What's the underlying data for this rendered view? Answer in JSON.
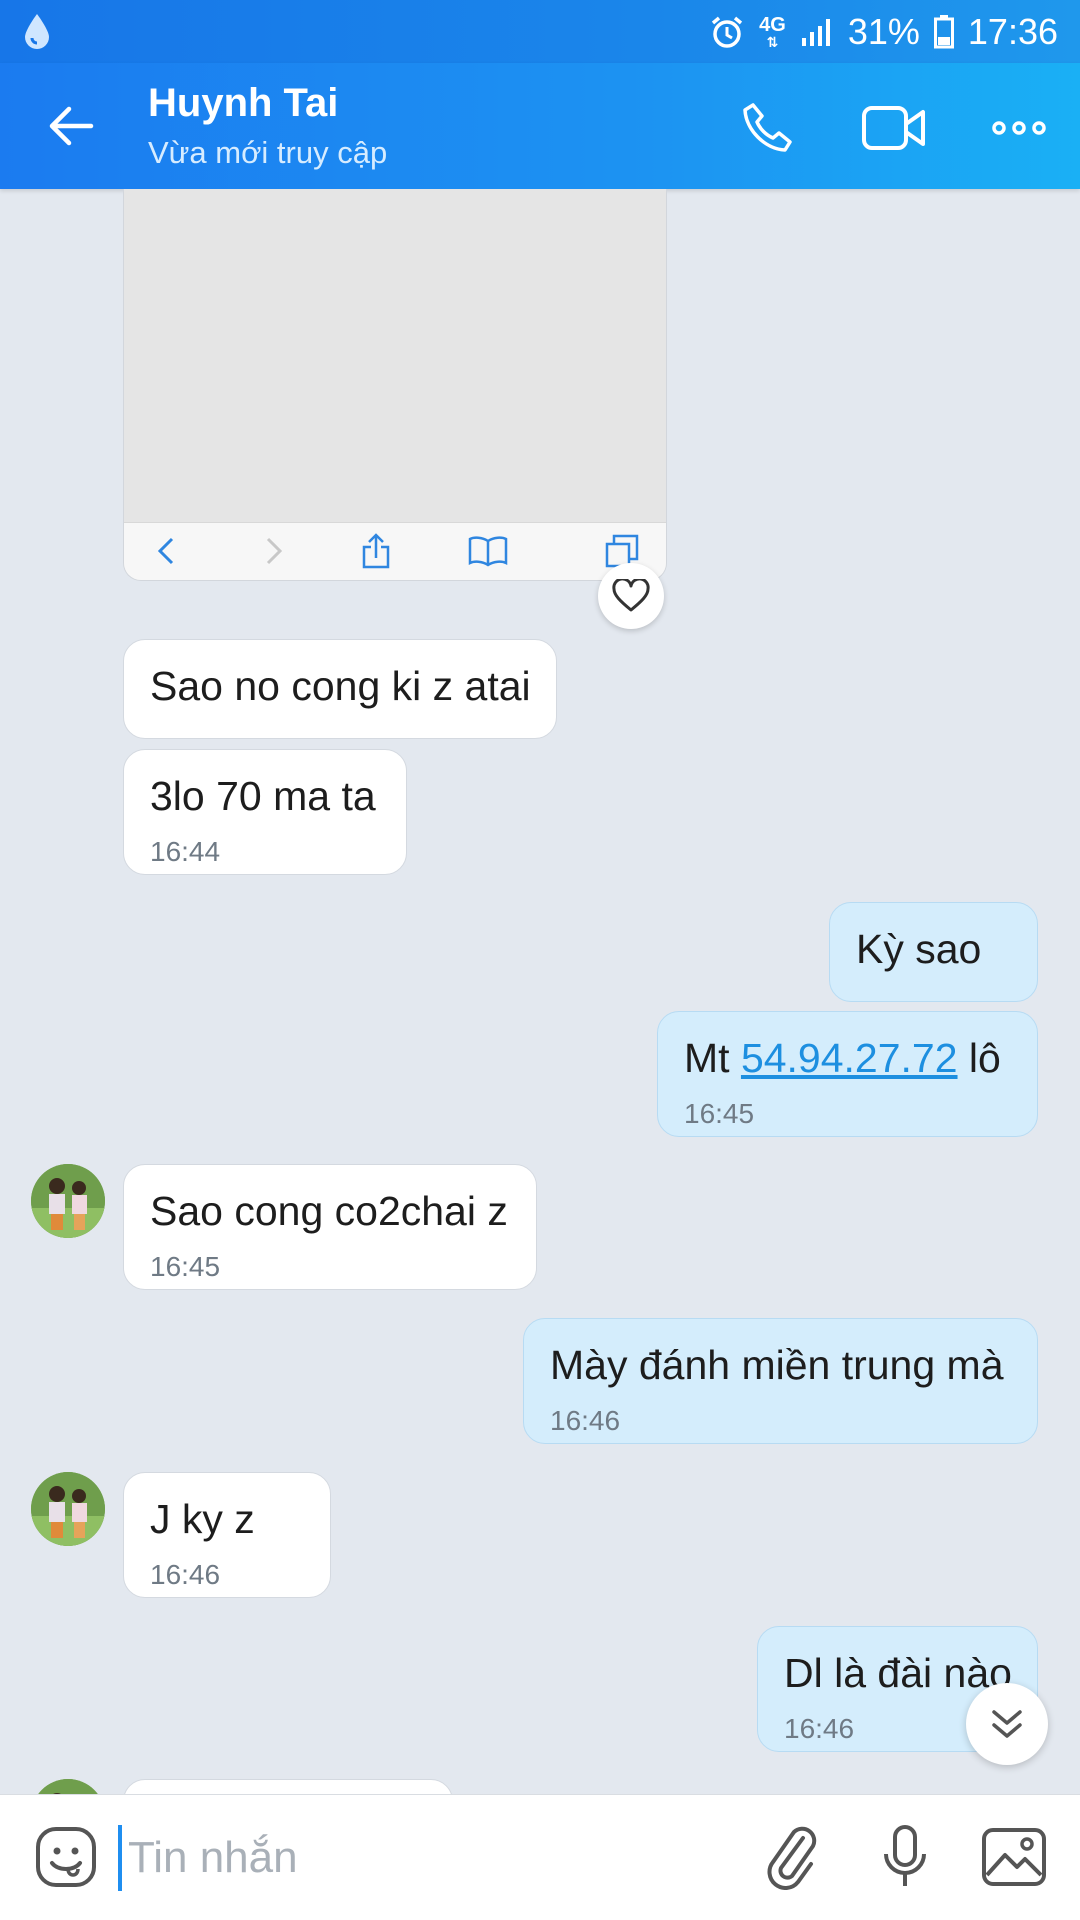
{
  "status_bar": {
    "icons": [
      "droplet-icon",
      "alarm-icon",
      "network-4g-icon",
      "signal-icon",
      "battery-icon"
    ],
    "network": "4G",
    "battery": "31%",
    "time": "17:36"
  },
  "header": {
    "contact_name": "Huynh Tai",
    "contact_status": "Vừa mới truy cập",
    "icons": [
      "back-arrow-icon",
      "phone-icon",
      "video-camera-icon",
      "more-icon"
    ]
  },
  "messages": [
    {
      "side": "in",
      "text": "Sao no cong ki z atai",
      "time": ""
    },
    {
      "side": "in",
      "text": "3lo 70 ma ta",
      "time": "16:44"
    },
    {
      "side": "out",
      "text": "Kỳ sao",
      "time": ""
    },
    {
      "side": "out",
      "text_before": "Mt ",
      "link": "54.94.27.72",
      "text_after": " lô",
      "time": "16:45"
    },
    {
      "side": "in",
      "text": "Sao cong co2chai z",
      "time": "16:45"
    },
    {
      "side": "out",
      "text": "Mày đánh miền trung mà",
      "time": "16:46"
    },
    {
      "side": "in",
      "text": "J ky z",
      "time": "16:46"
    },
    {
      "side": "out",
      "text": "Dl là đài nào",
      "time": "16:46"
    }
  ],
  "composer": {
    "placeholder": "Tin nhắn",
    "icons": [
      "emoji-icon",
      "paperclip-icon",
      "microphone-icon",
      "image-icon"
    ]
  },
  "colors": {
    "header_gradient_start": "#1b7bf0",
    "header_gradient_end": "#1ab0f5",
    "chat_background": "#e3e8ef",
    "outgoing_bubble": "#d4edfc",
    "incoming_bubble": "#ffffff",
    "link": "#1d8fe0"
  }
}
